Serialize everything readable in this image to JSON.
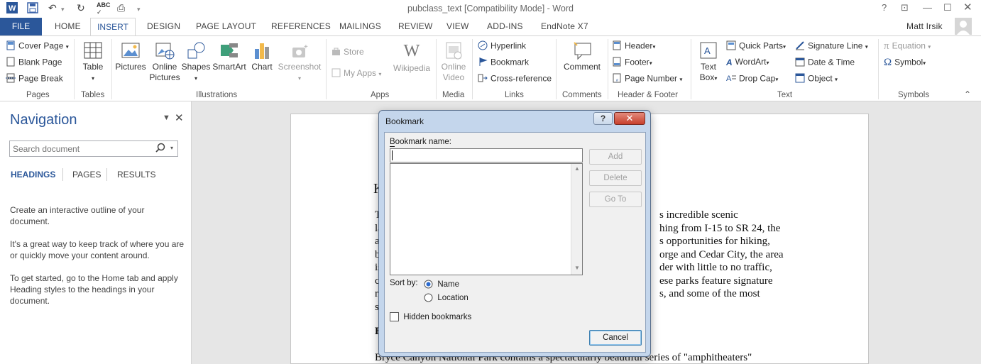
{
  "window": {
    "title": "pubclass_text [Compatibility Mode] - Word",
    "help": "?",
    "user": "Matt Irsik"
  },
  "tabs": {
    "file": "FILE",
    "home": "HOME",
    "insert": "INSERT",
    "design": "DESIGN",
    "page_layout": "PAGE LAYOUT",
    "references": "REFERENCES",
    "mailings": "MAILINGS",
    "review": "REVIEW",
    "view": "VIEW",
    "addins": "ADD-INS",
    "endnote": "EndNote X7"
  },
  "ribbon": {
    "pages": {
      "cover_page": "Cover Page",
      "blank_page": "Blank Page",
      "page_break": "Page Break",
      "group": "Pages"
    },
    "tables": {
      "table": "Table",
      "group": "Tables"
    },
    "illustrations": {
      "pictures": "Pictures",
      "online_pictures_1": "Online",
      "online_pictures_2": "Pictures",
      "shapes": "Shapes",
      "smartart": "SmartArt",
      "chart": "Chart",
      "screenshot": "Screenshot",
      "group": "Illustrations"
    },
    "apps": {
      "store": "Store",
      "my_apps": "My Apps",
      "wikipedia": "Wikipedia",
      "group": "Apps"
    },
    "media": {
      "online_video_1": "Online",
      "online_video_2": "Video",
      "group": "Media"
    },
    "links": {
      "hyperlink": "Hyperlink",
      "bookmark": "Bookmark",
      "cross_reference": "Cross-reference",
      "group": "Links"
    },
    "comments": {
      "comment": "Comment",
      "group": "Comments"
    },
    "header_footer": {
      "header": "Header",
      "footer": "Footer",
      "page_number": "Page Number",
      "group": "Header & Footer"
    },
    "text": {
      "text_box_1": "Text",
      "text_box_2": "Box",
      "quick_parts": "Quick Parts",
      "wordart": "WordArt",
      "drop_cap": "Drop Cap",
      "signature_line": "Signature Line",
      "date_time": "Date & Time",
      "object": "Object",
      "group": "Text"
    },
    "symbols": {
      "equation": "Equation",
      "symbol": "Symbol",
      "group": "Symbols"
    }
  },
  "navigation": {
    "title": "Navigation",
    "search_placeholder": "Search document",
    "tab_headings": "HEADINGS",
    "tab_pages": "PAGES",
    "tab_results": "RESULTS",
    "para1_l1": "Create an interactive outline of your",
    "para1_l2": "document.",
    "para2_l1": "It's a great way to keep track of where you are",
    "para2_l2": "or quickly move your content around.",
    "para3_l1": "To get started, go to the Home tab and apply",
    "para3_l2": "Heading styles to the headings in your",
    "para3_l3": "document."
  },
  "document": {
    "heading_char": "K",
    "lines_left": [
      "T",
      "la",
      "a",
      "b",
      "is",
      "c",
      "r",
      "s"
    ],
    "lines_right": [
      "s incredible scenic",
      "hing from I-15 to SR 24, the",
      "s opportunities for hiking,",
      "orge and Cedar City, the area",
      "der with little to no traffic,",
      "ese parks feature signature",
      "s, and some of the most"
    ],
    "heading2_char": "B",
    "last_line": "Bryce Canyon National Park contains a spectacularly beautiful series of \"amphitheaters\""
  },
  "dialog": {
    "title": "Bookmark",
    "help": "?",
    "name_label": "Bookmark name:",
    "name_value": "",
    "add": "Add",
    "delete": "Delete",
    "goto": "Go To",
    "sort_by": "Sort by:",
    "sort_name": "Name",
    "sort_location": "Location",
    "sort_selected": "Name",
    "hidden": "Hidden bookmarks",
    "hidden_checked": false,
    "cancel": "Cancel"
  },
  "colors": {
    "accent": "#2b579a",
    "dialog_frame": "#c4d6ec",
    "close_red": "#c7402d"
  }
}
